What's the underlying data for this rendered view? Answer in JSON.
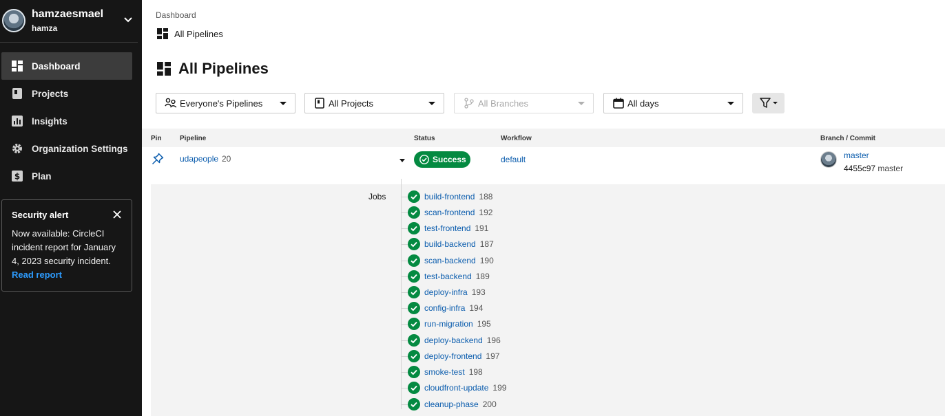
{
  "org": {
    "name": "hamzaesmael",
    "user": "hamza"
  },
  "nav": [
    {
      "label": "Dashboard",
      "icon": "dashboard-icon",
      "active": true
    },
    {
      "label": "Projects",
      "icon": "projects-icon"
    },
    {
      "label": "Insights",
      "icon": "insights-icon"
    },
    {
      "label": "Organization Settings",
      "icon": "gear-icon"
    },
    {
      "label": "Plan",
      "icon": "dollar-icon"
    }
  ],
  "alert": {
    "title": "Security alert",
    "body": "Now available: CircleCI incident report for January 4, 2023 security incident.",
    "link": "Read report"
  },
  "breadcrumb": "Dashboard",
  "subtitle": "All Pipelines",
  "page_title": "All Pipelines",
  "filters": {
    "pipelines": "Everyone's Pipelines",
    "projects": "All Projects",
    "branches": "All Branches",
    "days": "All days"
  },
  "table": {
    "headers": {
      "pin": "Pin",
      "pipeline": "Pipeline",
      "status": "Status",
      "workflow": "Workflow",
      "branch": "Branch / Commit"
    },
    "row": {
      "pipeline": "udapeople",
      "number": "20",
      "status": "Success",
      "workflow": "default",
      "branch": "master",
      "sha": "4455c97",
      "commit_branch": "master"
    }
  },
  "jobs_label": "Jobs",
  "jobs": [
    {
      "name": "build-frontend",
      "num": "188"
    },
    {
      "name": "scan-frontend",
      "num": "192"
    },
    {
      "name": "test-frontend",
      "num": "191"
    },
    {
      "name": "build-backend",
      "num": "187"
    },
    {
      "name": "scan-backend",
      "num": "190"
    },
    {
      "name": "test-backend",
      "num": "189"
    },
    {
      "name": "deploy-infra",
      "num": "193"
    },
    {
      "name": "config-infra",
      "num": "194"
    },
    {
      "name": "run-migration",
      "num": "195"
    },
    {
      "name": "deploy-backend",
      "num": "196"
    },
    {
      "name": "deploy-frontend",
      "num": "197"
    },
    {
      "name": "smoke-test",
      "num": "198"
    },
    {
      "name": "cloudfront-update",
      "num": "199"
    },
    {
      "name": "cleanup-phase",
      "num": "200"
    }
  ],
  "colors": {
    "sidebar": "#161616",
    "success": "#048a41",
    "link": "#0a5cad",
    "alert_link": "#2d9cff"
  }
}
